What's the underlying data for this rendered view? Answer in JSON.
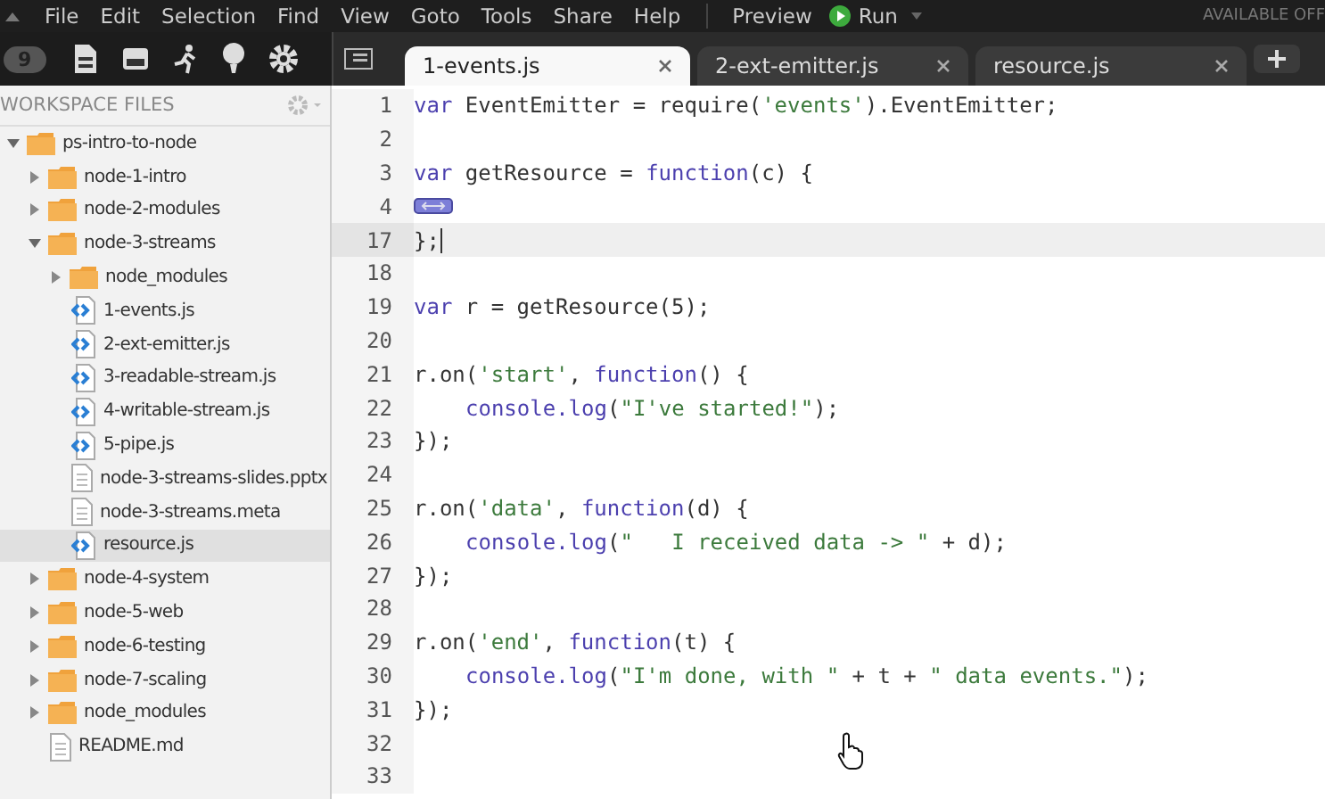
{
  "menu_bar": {
    "items": [
      "File",
      "Edit",
      "Selection",
      "Find",
      "View",
      "Goto",
      "Tools",
      "Share",
      "Help"
    ],
    "preview": "Preview",
    "run": "Run",
    "status": "AVAILABLE OFF"
  },
  "toolbar": {
    "badge": "9"
  },
  "tabs": [
    {
      "label": "1-events.js",
      "selected": true
    },
    {
      "label": "2-ext-emitter.js",
      "selected": false
    },
    {
      "label": "resource.js",
      "selected": false
    }
  ],
  "sidebar": {
    "title": "WORKSPACE FILES",
    "tree": [
      {
        "name": "ps-intro-to-node",
        "kind": "folder",
        "expanded": true,
        "selected": false,
        "children": [
          {
            "name": "node-1-intro",
            "kind": "folder",
            "expanded": false,
            "selected": false
          },
          {
            "name": "node-2-modules",
            "kind": "folder",
            "expanded": false,
            "selected": false
          },
          {
            "name": "node-3-streams",
            "kind": "folder",
            "expanded": true,
            "selected": false,
            "children": [
              {
                "name": "node_modules",
                "kind": "folder",
                "expanded": false,
                "selected": false
              },
              {
                "name": "1-events.js",
                "kind": "script",
                "selected": false
              },
              {
                "name": "2-ext-emitter.js",
                "kind": "script",
                "selected": false
              },
              {
                "name": "3-readable-stream.js",
                "kind": "script",
                "selected": false
              },
              {
                "name": "4-writable-stream.js",
                "kind": "script",
                "selected": false
              },
              {
                "name": "5-pipe.js",
                "kind": "script",
                "selected": false
              },
              {
                "name": "node-3-streams-slides.pptx",
                "kind": "document",
                "selected": false
              },
              {
                "name": "node-3-streams.meta",
                "kind": "document",
                "selected": false
              },
              {
                "name": "resource.js",
                "kind": "script",
                "selected": true
              }
            ]
          },
          {
            "name": "node-4-system",
            "kind": "folder",
            "expanded": false,
            "selected": false
          },
          {
            "name": "node-5-web",
            "kind": "folder",
            "expanded": false,
            "selected": false
          },
          {
            "name": "node-6-testing",
            "kind": "folder",
            "expanded": false,
            "selected": false
          },
          {
            "name": "node-7-scaling",
            "kind": "folder",
            "expanded": false,
            "selected": false
          },
          {
            "name": "node_modules",
            "kind": "folder",
            "expanded": false,
            "selected": false
          },
          {
            "name": "README.md",
            "kind": "document",
            "selected": false
          }
        ]
      }
    ]
  },
  "editor": {
    "lines": [
      {
        "number": "1",
        "current": false,
        "indent": false,
        "tokens": [
          {
            "kind": "keyword",
            "text": "var"
          },
          {
            "kind": "plain",
            "text": " EventEmitter = require("
          },
          {
            "kind": "string",
            "text": "'events'"
          },
          {
            "kind": "plain",
            "text": ").EventEmitter;"
          }
        ]
      },
      {
        "number": "2",
        "current": false
      },
      {
        "number": "3",
        "current": false,
        "indent": false,
        "tokens": [
          {
            "kind": "keyword",
            "text": "var"
          },
          {
            "kind": "plain",
            "text": " getResource = "
          },
          {
            "kind": "keyword",
            "text": "function"
          },
          {
            "kind": "plain",
            "text": "(c) {"
          }
        ]
      },
      {
        "number": "4",
        "current": false,
        "fold": true
      },
      {
        "number": "17",
        "current": true,
        "indent": false,
        "tokens": [
          {
            "kind": "plain",
            "text": "};"
          }
        ]
      },
      {
        "number": "18",
        "current": false
      },
      {
        "number": "19",
        "current": false,
        "indent": false,
        "tokens": [
          {
            "kind": "keyword",
            "text": "var"
          },
          {
            "kind": "plain",
            "text": " r = getResource(5);"
          }
        ]
      },
      {
        "number": "20",
        "current": false
      },
      {
        "number": "21",
        "current": false,
        "indent": false,
        "tokens": [
          {
            "kind": "plain",
            "text": "r.on("
          },
          {
            "kind": "string",
            "text": "'start'"
          },
          {
            "kind": "plain",
            "text": ", "
          },
          {
            "kind": "keyword",
            "text": "function"
          },
          {
            "kind": "plain",
            "text": "() {"
          }
        ]
      },
      {
        "number": "22",
        "current": false,
        "indent": true,
        "tokens": [
          {
            "kind": "keyword",
            "text": "console.log"
          },
          {
            "kind": "plain",
            "text": "("
          },
          {
            "kind": "string",
            "text": "\"I've started!\""
          },
          {
            "kind": "plain",
            "text": ");"
          }
        ]
      },
      {
        "number": "23",
        "current": false,
        "indent": false,
        "tokens": [
          {
            "kind": "plain",
            "text": "});"
          }
        ]
      },
      {
        "number": "24",
        "current": false
      },
      {
        "number": "25",
        "current": false,
        "indent": false,
        "tokens": [
          {
            "kind": "plain",
            "text": "r.on("
          },
          {
            "kind": "string",
            "text": "'data'"
          },
          {
            "kind": "plain",
            "text": ", "
          },
          {
            "kind": "keyword",
            "text": "function"
          },
          {
            "kind": "plain",
            "text": "(d) {"
          }
        ]
      },
      {
        "number": "26",
        "current": false,
        "indent": true,
        "tokens": [
          {
            "kind": "keyword",
            "text": "console.log"
          },
          {
            "kind": "plain",
            "text": "("
          },
          {
            "kind": "string",
            "text": "\"   I received data -> \""
          },
          {
            "kind": "plain",
            "text": " + d);"
          }
        ]
      },
      {
        "number": "27",
        "current": false,
        "indent": false,
        "tokens": [
          {
            "kind": "plain",
            "text": "});"
          }
        ]
      },
      {
        "number": "28",
        "current": false
      },
      {
        "number": "29",
        "current": false,
        "indent": false,
        "tokens": [
          {
            "kind": "plain",
            "text": "r.on("
          },
          {
            "kind": "string",
            "text": "'end'"
          },
          {
            "kind": "plain",
            "text": ", "
          },
          {
            "kind": "keyword",
            "text": "function"
          },
          {
            "kind": "plain",
            "text": "(t) {"
          }
        ]
      },
      {
        "number": "30",
        "current": false,
        "indent": true,
        "tokens": [
          {
            "kind": "keyword",
            "text": "console.log"
          },
          {
            "kind": "plain",
            "text": "("
          },
          {
            "kind": "string",
            "text": "\"I'm done, with \""
          },
          {
            "kind": "plain",
            "text": " + t + "
          },
          {
            "kind": "string",
            "text": "\" data events.\""
          },
          {
            "kind": "plain",
            "text": ");"
          }
        ]
      },
      {
        "number": "31",
        "current": false,
        "indent": false,
        "tokens": [
          {
            "kind": "plain",
            "text": "});"
          }
        ]
      },
      {
        "number": "32",
        "current": false
      },
      {
        "number": "33",
        "current": false
      }
    ]
  }
}
